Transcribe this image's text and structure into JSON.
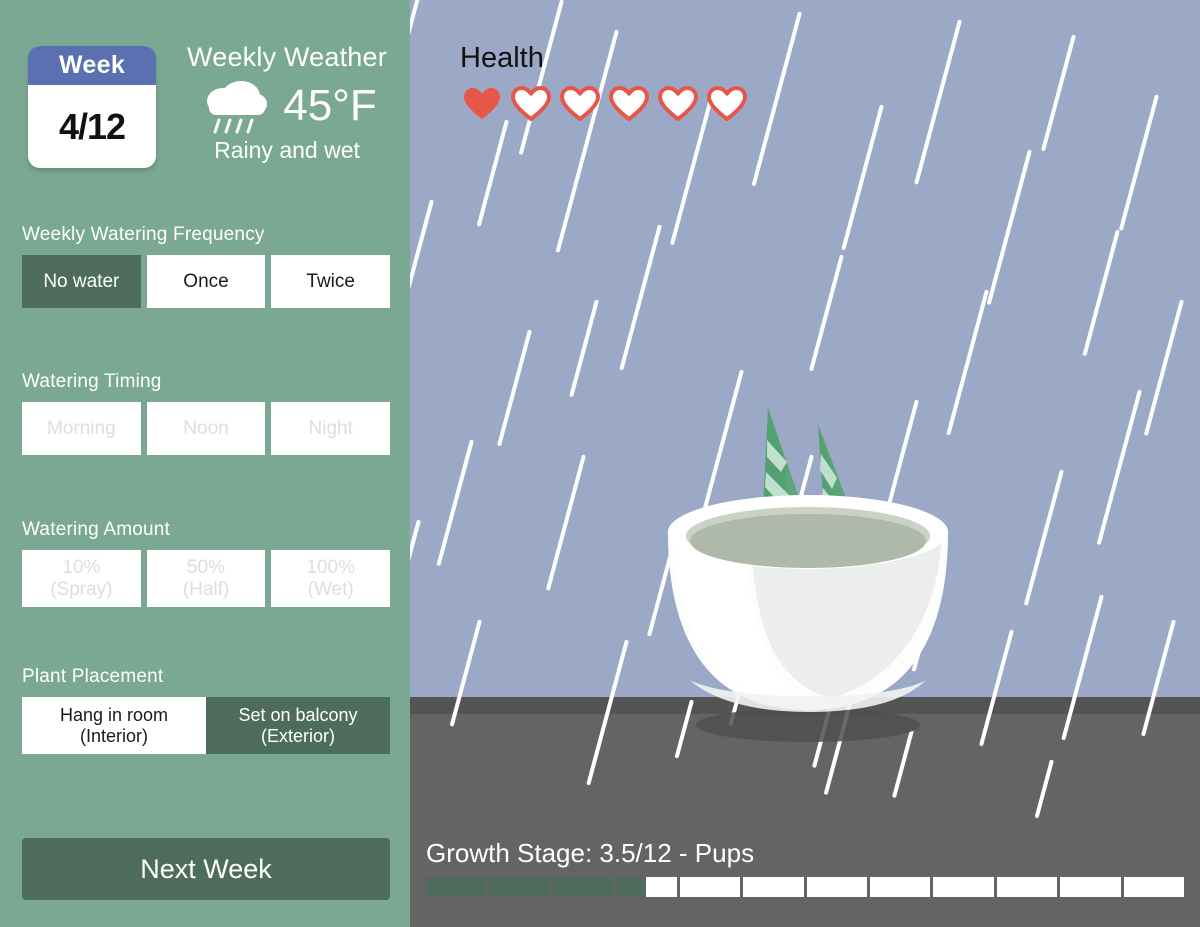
{
  "sidebar": {
    "calendar": {
      "header_label": "Week",
      "value": "4/12"
    },
    "weather": {
      "title": "Weekly Weather",
      "icon": "rain-cloud-icon",
      "temperature": "45°F",
      "description": "Rainy and wet"
    },
    "groups": [
      {
        "name": "watering-frequency",
        "label": "Weekly Watering Frequency",
        "options": [
          {
            "label": "No water",
            "selected": true,
            "disabled": false
          },
          {
            "label": "Once",
            "selected": false,
            "disabled": false
          },
          {
            "label": "Twice",
            "selected": false,
            "disabled": false
          }
        ]
      },
      {
        "name": "watering-timing",
        "label": "Watering Timing",
        "options": [
          {
            "label": "Morning",
            "selected": false,
            "disabled": true
          },
          {
            "label": "Noon",
            "selected": false,
            "disabled": true
          },
          {
            "label": "Night",
            "selected": false,
            "disabled": true
          }
        ]
      },
      {
        "name": "watering-amount",
        "label": "Watering Amount",
        "options": [
          {
            "label": "10%\n(Spray)",
            "selected": false,
            "disabled": true
          },
          {
            "label": "50%\n(Half)",
            "selected": false,
            "disabled": true
          },
          {
            "label": "100%\n(Wet)",
            "selected": false,
            "disabled": true
          }
        ]
      },
      {
        "name": "plant-placement",
        "label": "Plant Placement",
        "options": [
          {
            "label": "Hang in room\n(Interior)",
            "selected": false,
            "disabled": false
          },
          {
            "label": "Set on balcony\n(Exterior)",
            "selected": true,
            "disabled": false
          }
        ]
      }
    ],
    "next_week_label": "Next Week"
  },
  "scene": {
    "health": {
      "label": "Health",
      "total": 6,
      "filled": 1
    },
    "growth": {
      "label": "Growth Stage: 3.5/12 - Pups",
      "current": 3.5,
      "total": 12
    },
    "weather_state": "rain",
    "plant": {
      "type": "snake-plant",
      "leaves": 2,
      "pot": "white-ceramic"
    }
  },
  "colors": {
    "sidebar_green": "#7aa893",
    "selected_green": "#4e6c5c",
    "calendar_blue": "#5a70b0",
    "wall": "#9ba9c6",
    "floor": "#646464",
    "floor_shadow": "#545454",
    "heart_red": "#e8564a",
    "leaf_green": "#5aa678",
    "leaf_stripe": "#bfe0cd"
  }
}
